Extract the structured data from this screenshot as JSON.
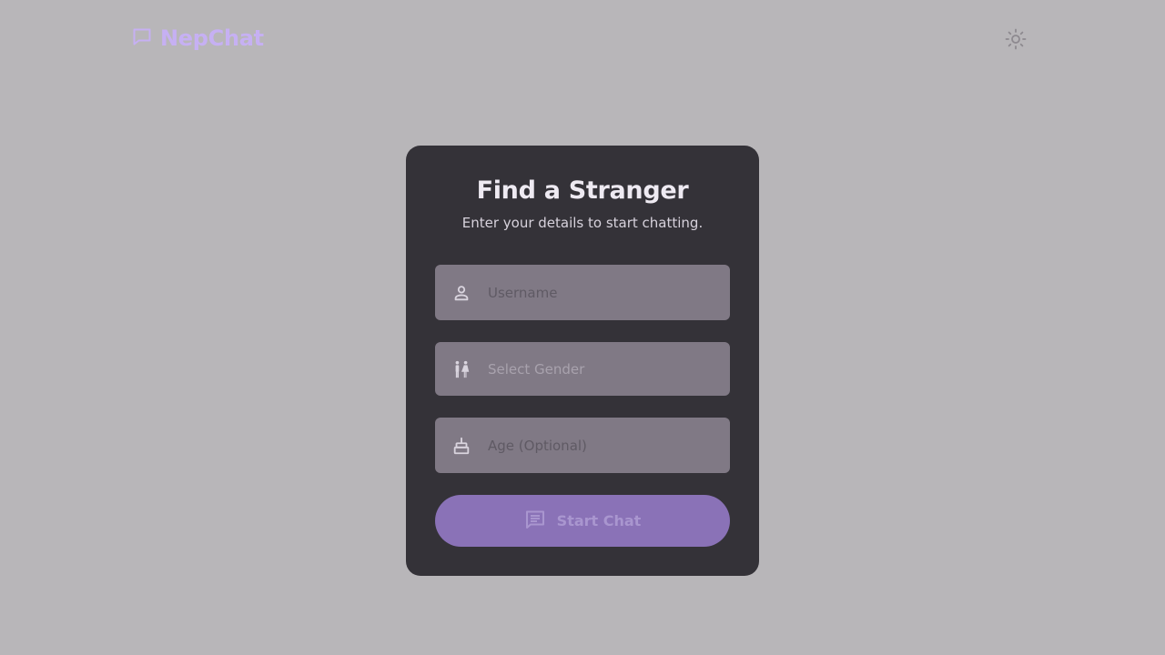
{
  "app": {
    "name": "NepChat"
  },
  "header": {
    "theme_toggle_icon": "sun-icon"
  },
  "card": {
    "title": "Find a Stranger",
    "subtitle": "Enter your details to start chatting."
  },
  "form": {
    "username": {
      "placeholder": "Username",
      "value": "",
      "icon": "user-icon"
    },
    "gender": {
      "placeholder": "Select Gender",
      "value": "",
      "icon": "gender-icon"
    },
    "age": {
      "placeholder": "Age (Optional)",
      "value": "",
      "icon": "cake-icon"
    },
    "submit": {
      "label": "Start Chat",
      "icon": "chat-icon"
    }
  },
  "colors": {
    "background": "#b8b6b9",
    "brand": "#c6b0f3",
    "card": "#343238",
    "field": "#807985",
    "button": "#8a72b7"
  }
}
